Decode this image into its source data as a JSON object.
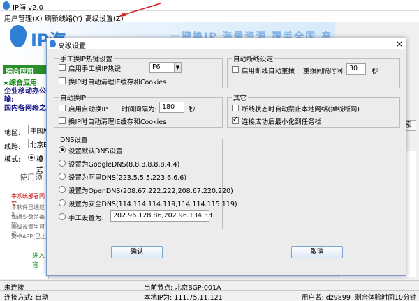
{
  "app": {
    "title": "IP海 v2.0"
  },
  "menu": {
    "items": [
      "用户管理(X)",
      "刷新线路(Y)",
      "高级设置(Z)"
    ]
  },
  "banner": {
    "logo_text": "IP海",
    "slogan": "一键换IP 海量资源 覆盖全国 高速稳定"
  },
  "left_panel": {
    "header": "综合应用",
    "green_line": "★综合应用",
    "blue_lines": [
      "企业移动办公",
      "输:",
      "国内各网络之"
    ],
    "region_label": "地区:",
    "region_value": "中国所",
    "line_label": "线路:",
    "line_value": "北京BG",
    "mode_label": "模式:",
    "mode_value": "模式",
    "usage_label": "使用须",
    "notice": "本系统部署同安",
    "notes": [
      "本软件已通过3",
      "如遇少数杀毒软",
      "高级设置里可设",
      "安卓APP(已上"
    ],
    "enter": "进入官"
  },
  "right_panel": {
    "search_label": "索",
    "region_text": "北京各地"
  },
  "dialog": {
    "title": "高级设置",
    "hotkey_group": {
      "title": "手工换IP热键设置",
      "enable_label": "启用手工换IP热键",
      "enable_checked": false,
      "hotkey_value": "F6",
      "clear_label": "换IP时自动清理IE缓存和Cookies",
      "clear_checked": false
    },
    "reconnect_group": {
      "title": "自动断线设定",
      "enable_label": "启用断线自动重拨",
      "enable_checked": false,
      "interval_label": "重拨间隔时间:",
      "interval_value": "30",
      "unit": "秒"
    },
    "auto_ip_group": {
      "title": "自动换IP",
      "enable_label": "启用自动换IP",
      "enable_checked": false,
      "interval_label": "时间间隔为:",
      "interval_value": "180",
      "unit": "秒",
      "clear_label": "换IP时自动清理IE缓存和Cookies",
      "clear_checked": false
    },
    "other_group": {
      "title": "其它",
      "opt1_label": "断线状态时自动禁止本地网络(掉线断网)",
      "opt1_checked": false,
      "opt2_label": "连接成功后最小化到任务栏",
      "opt2_checked": true
    },
    "dns_group": {
      "title": "DNS设置",
      "options": [
        {
          "label": "设置默认DNS设置",
          "selected": true
        },
        {
          "label": "设置为GoogleDNS(8.8.8.8,8.8.4.4)",
          "selected": false
        },
        {
          "label": "设置为阿里DNS(223.5.5.5,223.6.6.6)",
          "selected": false
        },
        {
          "label": "设置为OpenDNS(208.67.222.222,208.67.220.220)",
          "selected": false
        },
        {
          "label": "设置为安全DNS(114.114.114.119,114.114.115.119)",
          "selected": false
        },
        {
          "label": "手工设置为:",
          "selected": false
        }
      ],
      "manual_value": "202.96.128.86,202.96.134.33"
    },
    "ok_label": "确认",
    "cancel_label": "取消"
  },
  "status": {
    "connection": "未连接",
    "current_node": "当前节点: 北京BGP-001A",
    "connect_mode": "连接方式: 自动",
    "local_ip": "本地IP为: 111.75.11.121",
    "username": "用户名: dz9899",
    "remaining": "剩余体验时间10分钟"
  }
}
